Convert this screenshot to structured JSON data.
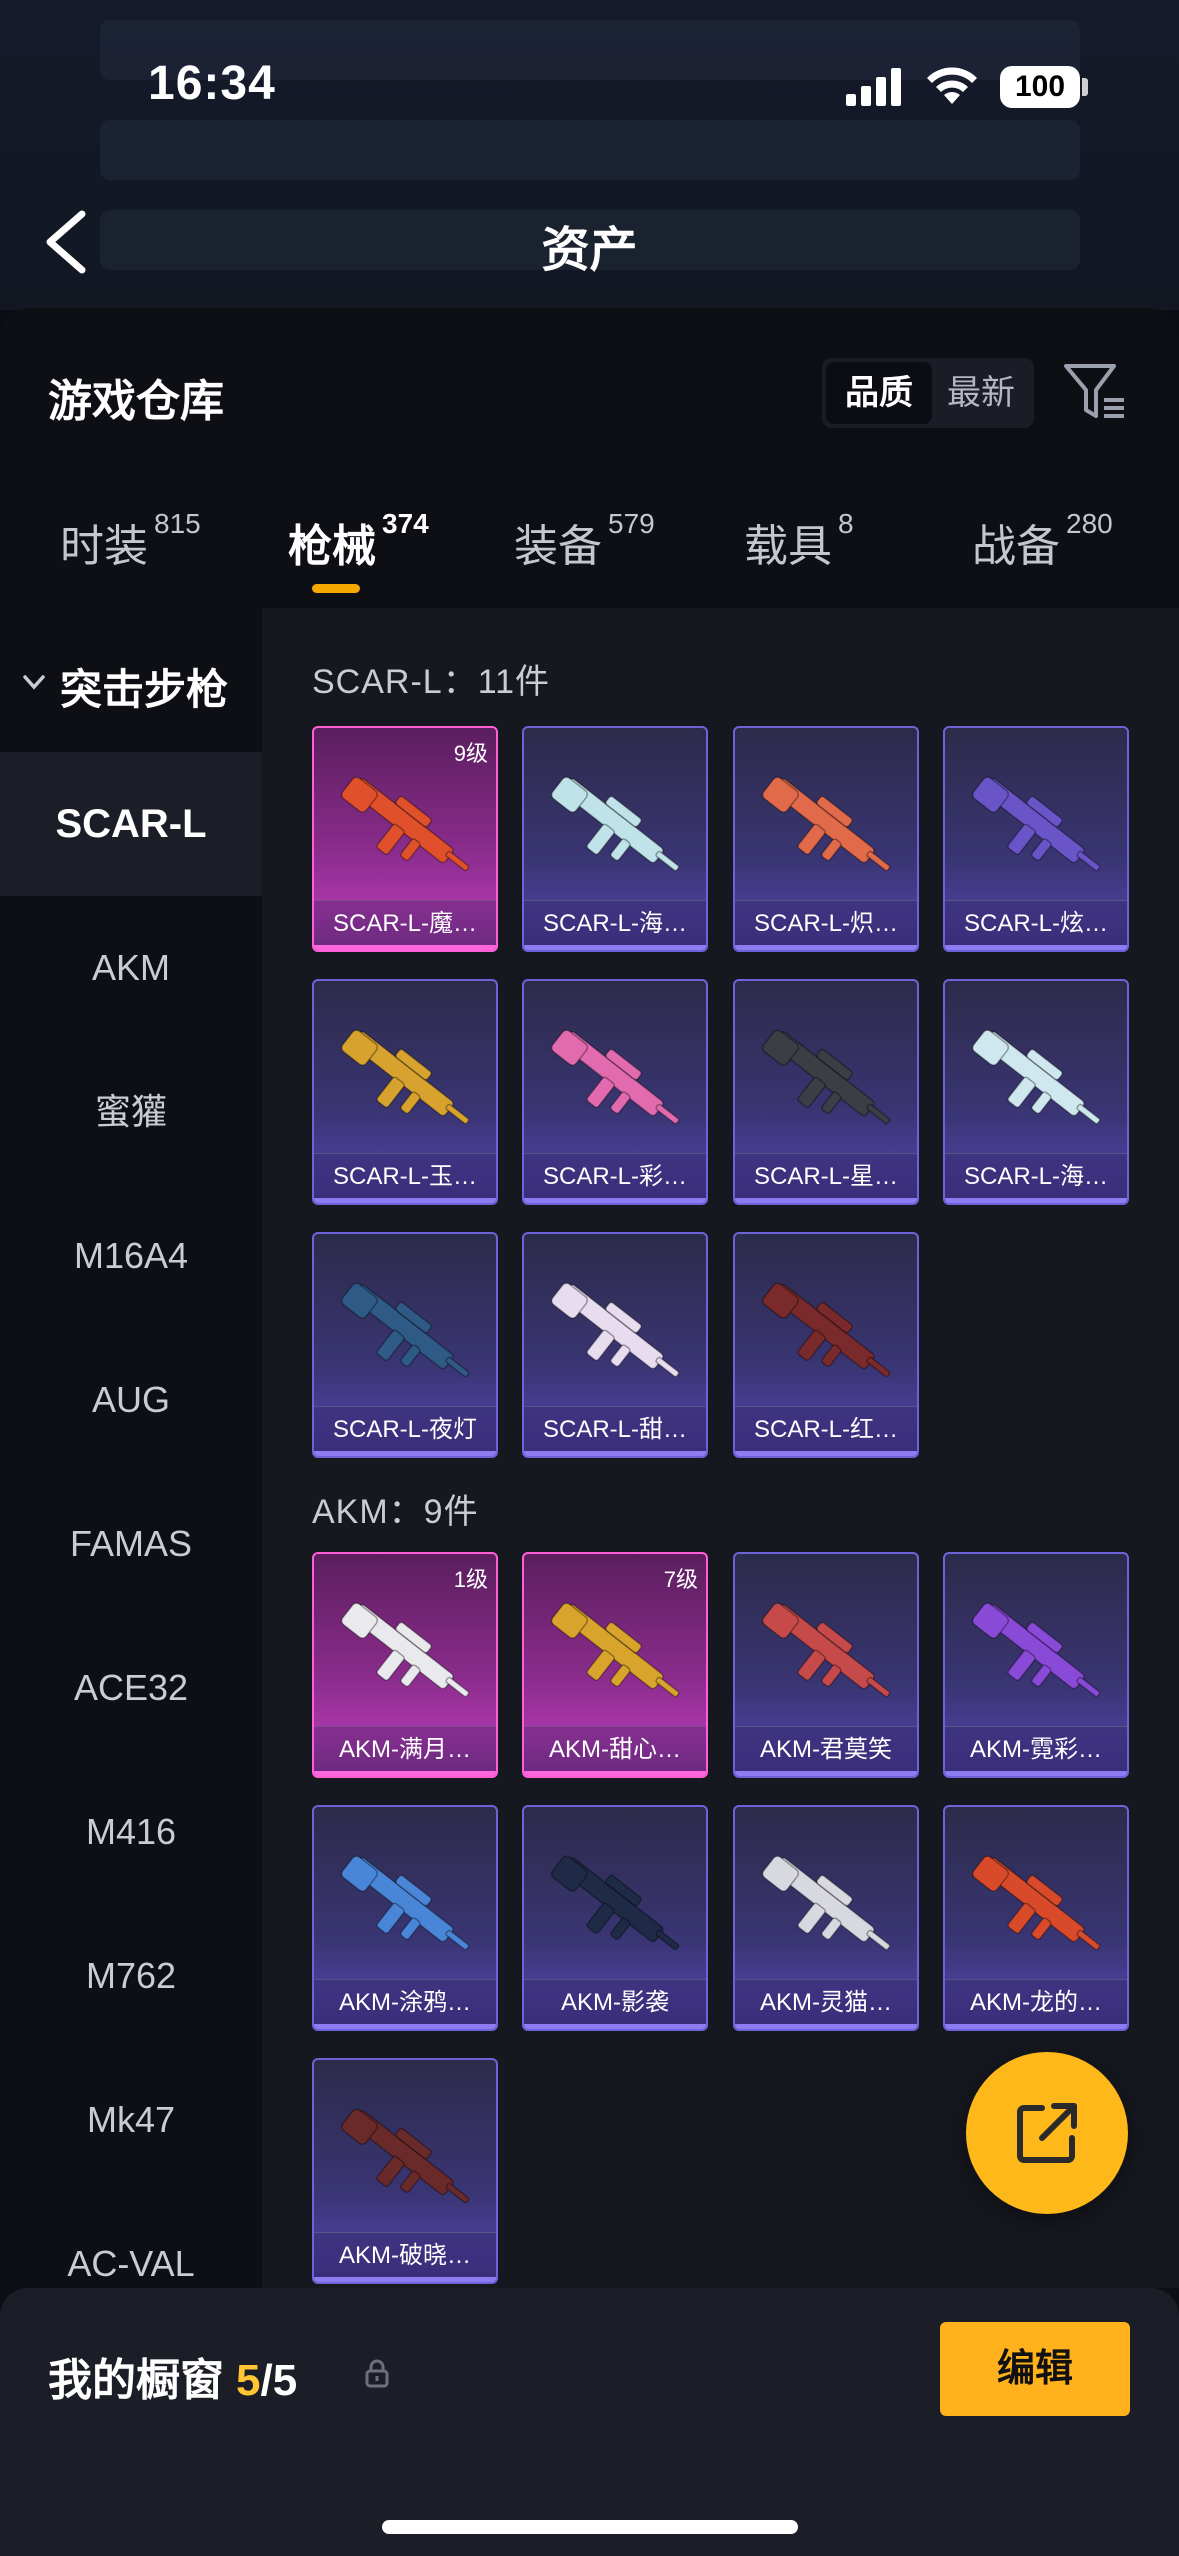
{
  "status_bar": {
    "time": "16:34",
    "battery": "100"
  },
  "nav": {
    "title": "资产"
  },
  "panel": {
    "title": "游戏仓库",
    "sort_options": [
      "品质",
      "最新"
    ]
  },
  "tabs": [
    {
      "label": "时装",
      "count": "815"
    },
    {
      "label": "枪械",
      "count": "374"
    },
    {
      "label": "装备",
      "count": "579"
    },
    {
      "label": "载具",
      "count": "8"
    },
    {
      "label": "战备",
      "count": "280"
    }
  ],
  "rail": {
    "header": "突击步枪",
    "items": [
      "SCAR-L",
      "AKM",
      "蜜獾",
      "M16A4",
      "AUG",
      "FAMAS",
      "ACE32",
      "M416",
      "M762",
      "Mk47",
      "AC-VAL"
    ]
  },
  "groups": [
    {
      "label": "SCAR-L：11件",
      "items": [
        {
          "name": "SCAR-L-魔…",
          "level": "9级",
          "tier": "mythic",
          "gun_color": "#e0502a"
        },
        {
          "name": "SCAR-L-海…",
          "level": "",
          "tier": "legend",
          "gun_color": "#bfe3e8"
        },
        {
          "name": "SCAR-L-炽…",
          "level": "",
          "tier": "legend",
          "gun_color": "#e06a4a"
        },
        {
          "name": "SCAR-L-炫…",
          "level": "",
          "tier": "legend",
          "gun_color": "#6a55c8"
        },
        {
          "name": "SCAR-L-玉…",
          "level": "",
          "tier": "legend",
          "gun_color": "#d7a32e"
        },
        {
          "name": "SCAR-L-彩…",
          "level": "",
          "tier": "legend",
          "gun_color": "#e26bb0"
        },
        {
          "name": "SCAR-L-星…",
          "level": "",
          "tier": "legend",
          "gun_color": "#3c3e46"
        },
        {
          "name": "SCAR-L-海…",
          "level": "",
          "tier": "legend",
          "gun_color": "#cfe8ef"
        },
        {
          "name": "SCAR-L-夜灯",
          "level": "",
          "tier": "legend",
          "gun_color": "#2f5a86"
        },
        {
          "name": "SCAR-L-甜…",
          "level": "",
          "tier": "legend",
          "gun_color": "#e8dcef"
        },
        {
          "name": "SCAR-L-红…",
          "level": "",
          "tier": "legend",
          "gun_color": "#7a2a2a"
        }
      ]
    },
    {
      "label": "AKM：9件",
      "items": [
        {
          "name": "AKM-满月…",
          "level": "1级",
          "tier": "mythic",
          "gun_color": "#e9e9ee"
        },
        {
          "name": "AKM-甜心…",
          "level": "7级",
          "tier": "mythic",
          "gun_color": "#d9a42b"
        },
        {
          "name": "AKM-君莫笑",
          "level": "",
          "tier": "legend",
          "gun_color": "#c64a4a"
        },
        {
          "name": "AKM-霓彩…",
          "level": "",
          "tier": "legend",
          "gun_color": "#8a4ad8"
        },
        {
          "name": "AKM-涂鸦…",
          "level": "",
          "tier": "legend",
          "gun_color": "#4a86d8"
        },
        {
          "name": "AKM-影袭",
          "level": "",
          "tier": "legend",
          "gun_color": "#1e2a46"
        },
        {
          "name": "AKM-灵猫…",
          "level": "",
          "tier": "legend",
          "gun_color": "#d8d8e0"
        },
        {
          "name": "AKM-龙的…",
          "level": "",
          "tier": "legend",
          "gun_color": "#d84a2a"
        },
        {
          "name": "AKM-破晓…",
          "level": "",
          "tier": "legend",
          "gun_color": "#6a2a2a"
        }
      ]
    }
  ],
  "bottom": {
    "window_label": "我的橱窗",
    "used": "5",
    "total": "/5",
    "edit_label": "编辑"
  },
  "colors": {
    "accent": "#ffb21c",
    "mythic_border": "#ff5fd4",
    "legend_border": "#6d63d8"
  }
}
